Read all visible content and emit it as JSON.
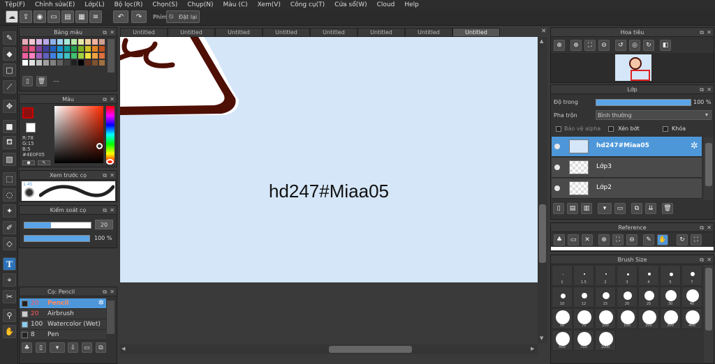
{
  "menu": [
    "Tệp(F)",
    "Chỉnh sửa(E)",
    "Lớp(L)",
    "Bộ lọc(R)",
    "Chọn(S)",
    "Chụp(N)",
    "Màu (C)",
    "Xem(V)",
    "Công cụ(T)",
    "Cửa sổ(W)",
    "Cloud",
    "Help"
  ],
  "toolbar": {
    "phim_label": "Phím",
    "reset_label": "Đặt lại"
  },
  "tabs": [
    "Untitled",
    "Untitled",
    "Untitled",
    "Untitled",
    "Untitled",
    "Untitled",
    "Untitled",
    "Untitled"
  ],
  "palette": {
    "title": "Bảng màu",
    "swatches": [
      "#e8a9b8",
      "#f2c6d2",
      "#d9b3e6",
      "#b9a8e8",
      "#8fb0e8",
      "#9fd4f0",
      "#a8e8d8",
      "#b8e8a8",
      "#e8e8a8",
      "#f0d0a0",
      "#f0b0a0",
      "#d0a090",
      "#c04060",
      "#e05080",
      "#8040a0",
      "#4040a0",
      "#2060c0",
      "#1890d0",
      "#10a0a0",
      "#20a050",
      "#80b020",
      "#d0c020",
      "#e08020",
      "#c05020",
      "#f060a0",
      "#ff80c0",
      "#a060c0",
      "#6060c0",
      "#4080e0",
      "#40b0e0",
      "#40c0c0",
      "#40c070",
      "#a0d040",
      "#f0e040",
      "#f0a040",
      "#e07040",
      "#ffffff",
      "#e0e0e0",
      "#c0c0c0",
      "#a0a0a0",
      "#808080",
      "#606060",
      "#404040",
      "#202020",
      "#000000",
      "#603020",
      "#805030",
      "#a07040"
    ],
    "placeholder_text": "---"
  },
  "color": {
    "title": "Màu",
    "r": "R:78",
    "g": "G:15",
    "b": "B:5",
    "hex": "#4E0F05",
    "fg": "#8b1010"
  },
  "brush_preview": {
    "title": "Xem trước cọ",
    "size_label": "1.45"
  },
  "brush_control": {
    "title": "Kiểm soát cọ",
    "size_value": "20",
    "size_fraction": 0.2,
    "opacity_value": "100 %",
    "opacity_fraction": 1.0
  },
  "brush_list": {
    "title": "Cọ: Pencil",
    "items": [
      {
        "size": "20",
        "name": "Pencil",
        "color": "#222222"
      },
      {
        "size": "20",
        "name": "Airbrush",
        "color": "#cccccc"
      },
      {
        "size": "100",
        "name": "Watercolor (Wet)",
        "color": "#88ccee"
      },
      {
        "size": "8",
        "name": "Pen",
        "color": "#222222"
      }
    ]
  },
  "canvas": {
    "text": "hd247#Miaa05"
  },
  "navigator": {
    "title": "Hoa tiêu"
  },
  "layer": {
    "title": "Lớp",
    "opacity_label": "Độ trong",
    "opacity_value": "100 %",
    "opacity_fraction": 1.0,
    "blend_label": "Pha trộn",
    "blend_value": "Bình thường",
    "protect_alpha": "Bảo vệ alpha",
    "clipping": "Xén bớt",
    "lock": "Khóa",
    "layers": [
      {
        "name": "hd247#Miaa05"
      },
      {
        "name": "Lớp3"
      },
      {
        "name": "Lớp2"
      }
    ]
  },
  "reference": {
    "title": "Reference"
  },
  "brush_size": {
    "title": "Brush Size",
    "sizes": [
      "1",
      "1.5",
      "2",
      "3",
      "4",
      "5",
      "7",
      "10",
      "12",
      "15",
      "20",
      "25",
      "30",
      "40",
      "50",
      "70",
      "100",
      "150",
      "200",
      "300",
      "400",
      "500",
      "700",
      "1000"
    ]
  }
}
